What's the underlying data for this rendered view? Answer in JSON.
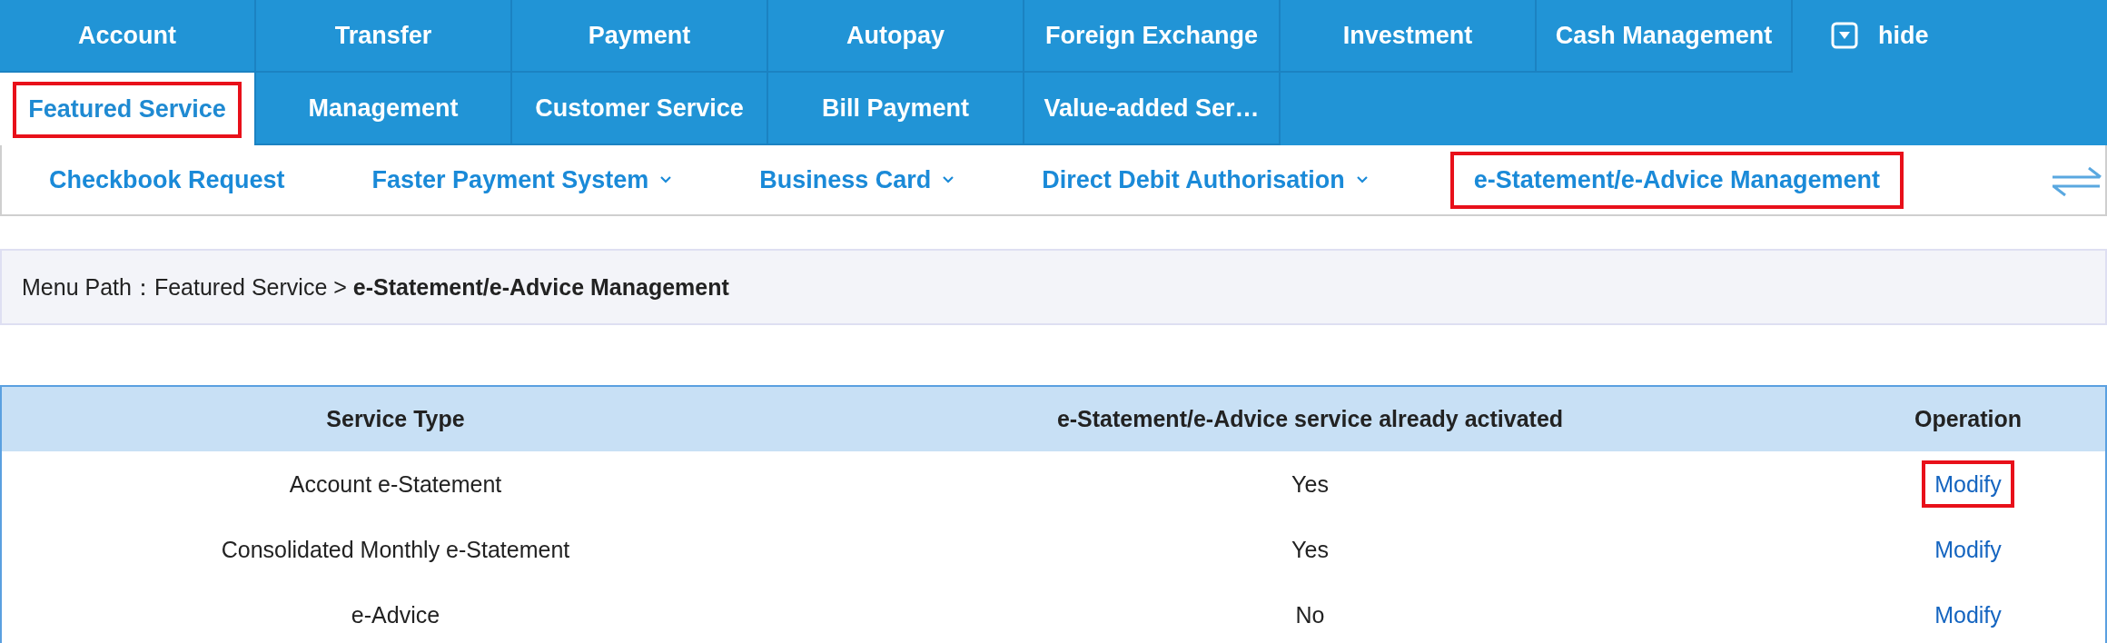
{
  "main_menu": {
    "rows": [
      {
        "items": [
          {
            "label": "Account",
            "selected": false,
            "highlighted": false
          },
          {
            "label": "Transfer",
            "selected": false,
            "highlighted": false
          },
          {
            "label": "Payment",
            "selected": false,
            "highlighted": false
          },
          {
            "label": "Autopay",
            "selected": false,
            "highlighted": false
          },
          {
            "label": "Foreign Exchange",
            "selected": false,
            "highlighted": false
          },
          {
            "label": "Investment",
            "selected": false,
            "highlighted": false
          },
          {
            "label": "Cash Management",
            "selected": false,
            "highlighted": false
          }
        ]
      },
      {
        "items": [
          {
            "label": "Featured Service",
            "selected": true,
            "highlighted": true
          },
          {
            "label": "Management",
            "selected": false,
            "highlighted": false
          },
          {
            "label": "Customer Service",
            "selected": false,
            "highlighted": false
          },
          {
            "label": "Bill Payment",
            "selected": false,
            "highlighted": false
          },
          {
            "label": "Value-added Ser…",
            "selected": false,
            "highlighted": false
          }
        ]
      }
    ],
    "hide_button": {
      "label": "hide"
    }
  },
  "sub_menu": {
    "items": [
      {
        "label": "Checkbook Request",
        "dropdown": false,
        "highlighted": false
      },
      {
        "label": "Faster Payment System",
        "dropdown": true,
        "highlighted": false
      },
      {
        "label": "Business Card",
        "dropdown": true,
        "highlighted": false
      },
      {
        "label": "Direct Debit Authorisation",
        "dropdown": true,
        "highlighted": false
      },
      {
        "label": "e-Statement/e-Advice Management",
        "dropdown": false,
        "highlighted": true
      }
    ]
  },
  "menu_path": "Menu Path：Featured Service > **e-Statement/e-Advice Management**",
  "table": {
    "columns": [
      "Service Type",
      "e-Statement/e-Advice service already activated",
      "Operation"
    ],
    "rows": [
      {
        "service_type": "Account e-Statement",
        "activated": "Yes",
        "operation": {
          "label": "Modify",
          "highlighted": true
        }
      },
      {
        "service_type": "Consolidated Monthly e-Statement",
        "activated": "Yes",
        "operation": {
          "label": "Modify",
          "highlighted": false
        }
      },
      {
        "service_type": "e-Advice",
        "activated": "No",
        "operation": {
          "label": "Modify",
          "highlighted": false
        }
      }
    ]
  }
}
